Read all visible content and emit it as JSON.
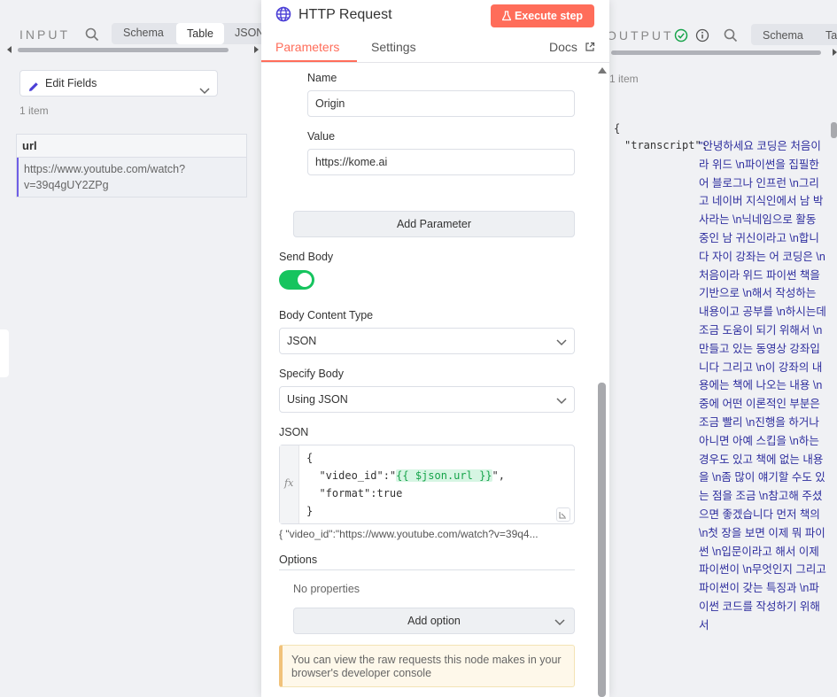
{
  "input_pane": {
    "title": "INPUT",
    "tabs": [
      "Schema",
      "Table",
      "JSON"
    ],
    "active_tab": "Table",
    "node_select": "Edit Fields",
    "item_count": "1 item",
    "table": {
      "header": "url",
      "rows": [
        "https://www.youtube.com/watch?v=39q4gUY2ZPg"
      ]
    }
  },
  "node_panel": {
    "title": "HTTP Request",
    "execute_label": "Execute step",
    "tabs": [
      "Parameters",
      "Settings"
    ],
    "active_tab": "Parameters",
    "docs_label": "Docs",
    "header_param": {
      "name_label": "Name",
      "name_value": "Origin",
      "value_label": "Value",
      "value_value": "https://kome.ai"
    },
    "add_parameter_label": "Add Parameter",
    "send_body_label": "Send Body",
    "send_body_on": true,
    "body_content_type_label": "Body Content Type",
    "body_content_type_value": "JSON",
    "specify_body_label": "Specify Body",
    "specify_body_value": "Using JSON",
    "json_label": "JSON",
    "json_lines": {
      "open": "{",
      "video_prefix": "  \"video_id\":\"",
      "video_expr": "{{ $json.url }}",
      "video_suffix": "\",",
      "format_line": "  \"format\":true",
      "close": "}"
    },
    "json_preview": "{  \"video_id\":\"https://www.youtube.com/watch?v=39q4...",
    "options_label": "Options",
    "no_properties": "No properties",
    "add_option_label": "Add option",
    "notice_text": "You can view the raw requests this node makes in your browser's developer console"
  },
  "output_pane": {
    "title": "OUTPUT",
    "tabs": [
      "Schema",
      "Table"
    ],
    "item_count": "1 item",
    "json_open": "{",
    "key": "\"transcript\":",
    "value": "\"안녕하세요 코딩은 처음이라 위드 \\n파이썬을 집필한 어 블로그나 인프런 \\n그리고 네이버 지식인에서 남 박사라는 \\n닉네임으로 활동 중인 남 귀신이라고 \\n합니다 자이 강좌는 어 코딩은 \\n처음이라 위드 파이썬 책을 기반으로 \\n해서 작성하는 내용이고 공부를 \\n하시는데 조금 도움이 되기 위해서 \\n만들고 있는 동영상 강좌입니다 그리고 \\n이 강좌의 내용에는 책에 나오는 내용 \\n중에 어떤 이론적인 부분은 조금 빨리 \\n진행을 하거나 아니면 아예 스킵을 \\n하는 경우도 있고 책에 없는 내용을 \\n좀 많이 얘기할 수도 있는 점을 조금 \\n참고해 주셨으면 좋겠습니다 먼저 책의 \\n첫 장을 보면 이제 뭐 파이썬 \\n입문이라고 해서 이제 파이썬이 \\n무엇인지 그리고 파이썬이 갖는 특징과 \\n파이썬 코드를 작성하기 위해서"
  },
  "colors": {
    "accent": "#ff6d5a",
    "toggle_on": "#16c45e",
    "success": "#16a34a",
    "info": "#555555",
    "json_value": "#2e2e9e"
  },
  "icons": [
    "search-icon",
    "pen-icon",
    "chevron-down-icon",
    "globe-icon",
    "flask-icon",
    "external-link-icon",
    "check-circle-icon",
    "info-icon",
    "resize-icon"
  ]
}
